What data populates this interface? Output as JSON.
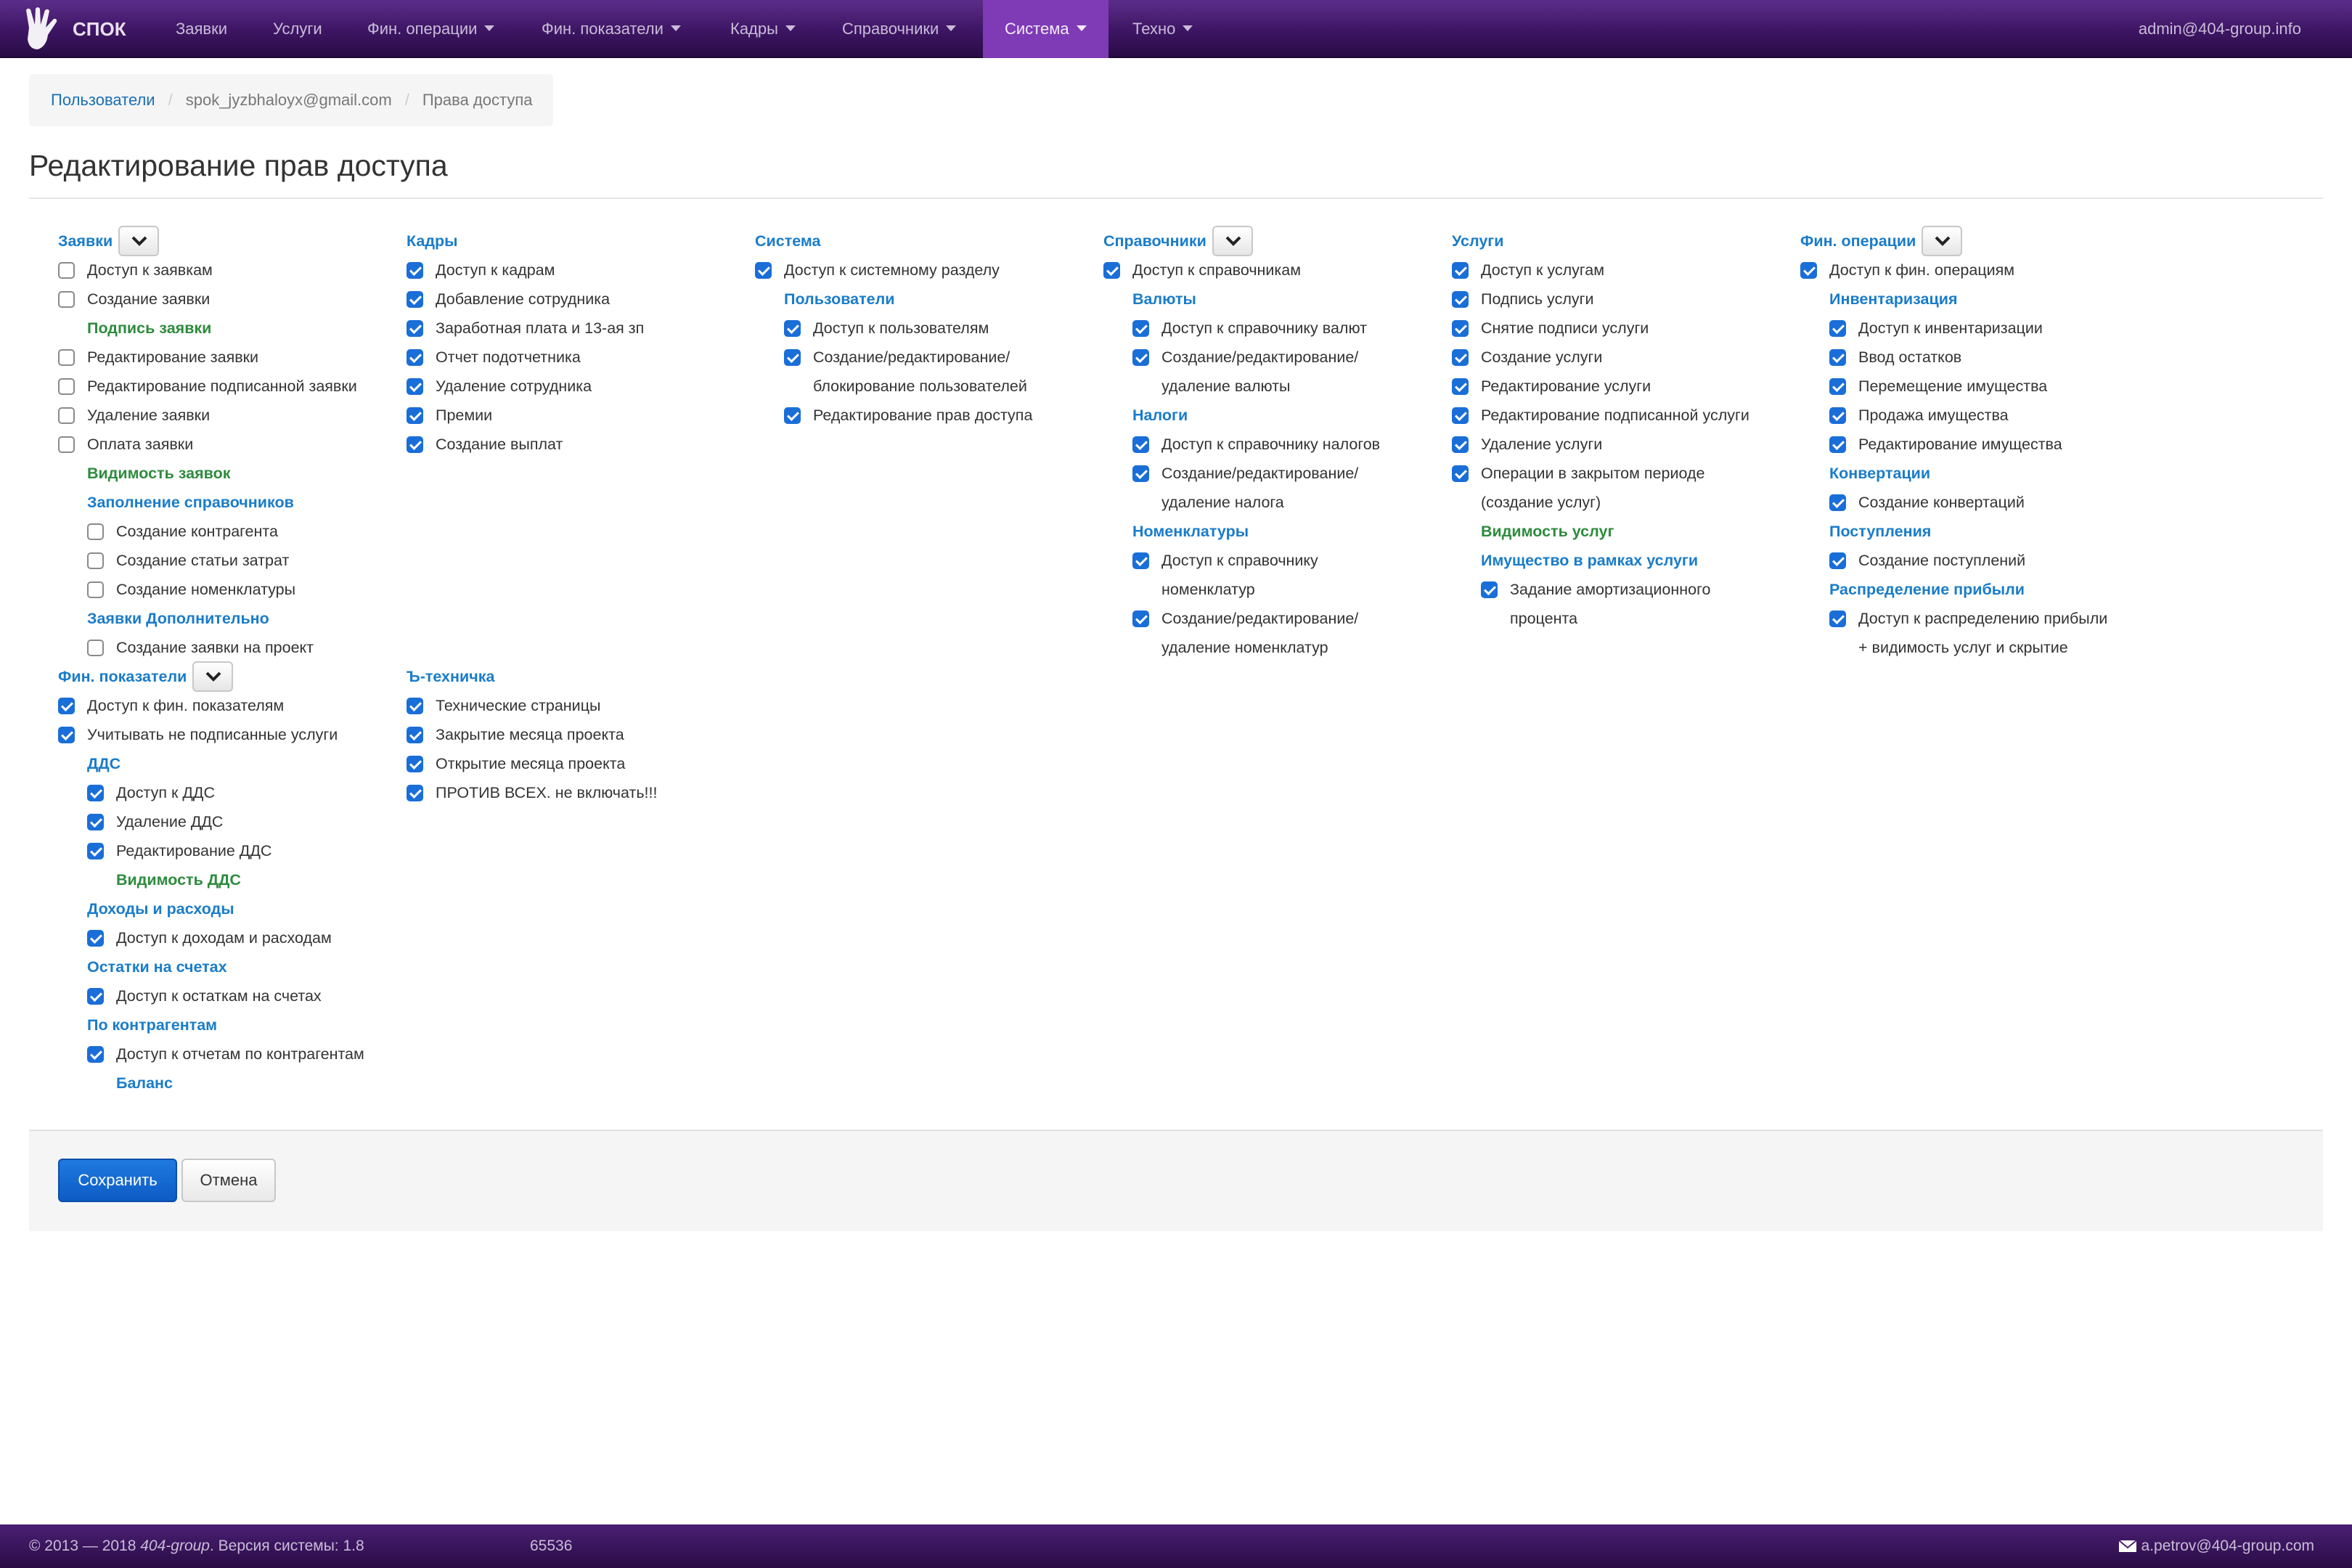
{
  "nav": {
    "brand": "СПОК",
    "items": [
      {
        "label": "Заявки",
        "dropdown": false,
        "active": false
      },
      {
        "label": "Услуги",
        "dropdown": false,
        "active": false
      },
      {
        "label": "Фин. операции",
        "dropdown": true,
        "active": false
      },
      {
        "label": "Фин. показатели",
        "dropdown": true,
        "active": false
      },
      {
        "label": "Кадры",
        "dropdown": true,
        "active": false
      },
      {
        "label": "Справочники",
        "dropdown": true,
        "active": false
      },
      {
        "label": "Система",
        "dropdown": true,
        "active": true
      },
      {
        "label": "Техно",
        "dropdown": true,
        "active": false
      }
    ],
    "user": "admin@404-group.info"
  },
  "breadcrumb": {
    "items": [
      "Пользователи",
      "spok_jyzbhaloyx@gmail.com",
      "Права доступа"
    ]
  },
  "page_title": "Редактирование прав доступа",
  "columns": [
    {
      "groups": [
        {
          "title": "Заявки",
          "toggle": true,
          "items": [
            {
              "type": "cb",
              "label": "Доступ к заявкам",
              "checked": false
            },
            {
              "type": "cb",
              "label": "Создание заявки",
              "checked": false
            },
            {
              "type": "green",
              "label": "Подпись заявки",
              "indent": 1
            },
            {
              "type": "cb",
              "label": "Редактирование заявки",
              "checked": false
            },
            {
              "type": "cb",
              "label": "Редактирование подписанной заявки",
              "checked": false
            },
            {
              "type": "cb",
              "label": "Удаление заявки",
              "checked": false
            },
            {
              "type": "cb",
              "label": "Оплата заявки",
              "checked": false
            },
            {
              "type": "green",
              "label": "Видимость заявок",
              "indent": 1
            },
            {
              "type": "head",
              "label": "Заполнение справочников",
              "indent": 1
            },
            {
              "type": "cb",
              "label": "Создание контрагента",
              "checked": false,
              "indent": 1
            },
            {
              "type": "cb",
              "label": "Создание статьи затрат",
              "checked": false,
              "indent": 1
            },
            {
              "type": "cb",
              "label": "Создание номенклатуры",
              "checked": false,
              "indent": 1
            },
            {
              "type": "head",
              "label": "Заявки Дополнительно",
              "indent": 1
            },
            {
              "type": "cb",
              "label": "Создание заявки на проект",
              "checked": false,
              "indent": 1
            }
          ]
        },
        {
          "title": "Фин. показатели",
          "toggle": true,
          "items": [
            {
              "type": "cb",
              "label": "Доступ к фин. показателям",
              "checked": true
            },
            {
              "type": "cb",
              "label": "Учитывать не подписанные услуги",
              "checked": true
            },
            {
              "type": "head",
              "label": "ДДС",
              "indent": 1
            },
            {
              "type": "cb",
              "label": "Доступ к ДДС",
              "checked": true,
              "indent": 1
            },
            {
              "type": "cb",
              "label": "Удаление ДДС",
              "checked": true,
              "indent": 1
            },
            {
              "type": "cb",
              "label": "Редактирование ДДС",
              "checked": true,
              "indent": 1
            },
            {
              "type": "green",
              "label": "Видимость ДДС",
              "indent": 2
            },
            {
              "type": "head",
              "label": "Доходы и расходы",
              "indent": 1
            },
            {
              "type": "cb",
              "label": "Доступ к доходам и расходам",
              "checked": true,
              "indent": 1
            },
            {
              "type": "head",
              "label": "Остатки на счетах",
              "indent": 1
            },
            {
              "type": "cb",
              "label": "Доступ к остаткам на счетах",
              "checked": true,
              "indent": 1
            },
            {
              "type": "head",
              "label": "По контрагентам",
              "indent": 1
            },
            {
              "type": "cb",
              "label": "Доступ к отчетам по контрагентам",
              "checked": true,
              "indent": 1
            },
            {
              "type": "head",
              "label": "Баланс",
              "indent": 2
            }
          ]
        }
      ]
    },
    {
      "groups": [
        {
          "title": "Кадры",
          "toggle": false,
          "items": [
            {
              "type": "cb",
              "label": "Доступ к кадрам",
              "checked": true
            },
            {
              "type": "cb",
              "label": "Добавление сотрудника",
              "checked": true
            },
            {
              "type": "cb",
              "label": "Заработная плата и 13-ая зп",
              "checked": true
            },
            {
              "type": "cb",
              "label": "Отчет подотчетника",
              "checked": true
            },
            {
              "type": "cb",
              "label": "Удаление сотрудника",
              "checked": true
            },
            {
              "type": "cb",
              "label": "Премии",
              "checked": true
            },
            {
              "type": "cb",
              "label": "Создание выплат",
              "checked": true
            },
            {
              "type": "spacer",
              "count": 7
            }
          ]
        },
        {
          "title": "Ъ-техничка",
          "toggle": false,
          "items": [
            {
              "type": "cb",
              "label": "Технические страницы",
              "checked": true
            },
            {
              "type": "cb",
              "label": "Закрытие месяца проекта",
              "checked": true
            },
            {
              "type": "cb",
              "label": "Открытие месяца проекта",
              "checked": true
            },
            {
              "type": "cb",
              "label": "ПРОТИВ ВСЕХ. не включать!!!",
              "checked": true
            }
          ]
        }
      ]
    },
    {
      "groups": [
        {
          "title": "Система",
          "toggle": false,
          "items": [
            {
              "type": "cb",
              "label": "Доступ к системному разделу",
              "checked": true
            },
            {
              "type": "head",
              "label": "Пользователи",
              "indent": 1
            },
            {
              "type": "cb",
              "label": "Доступ к пользователям",
              "checked": true,
              "indent": 1
            },
            {
              "type": "cb",
              "label": "Создание/редактирование/",
              "checked": true,
              "indent": 1
            },
            {
              "type": "cont",
              "label": "блокирование пользователей",
              "indent": 1
            },
            {
              "type": "cb",
              "label": "Редактирование прав доступа",
              "checked": true,
              "indent": 1
            }
          ]
        }
      ]
    },
    {
      "groups": [
        {
          "title": "Справочники",
          "toggle": true,
          "items": [
            {
              "type": "cb",
              "label": "Доступ к справочникам",
              "checked": true
            },
            {
              "type": "head",
              "label": "Валюты",
              "indent": 1
            },
            {
              "type": "cb",
              "label": "Доступ к справочнику валют",
              "checked": true,
              "indent": 1
            },
            {
              "type": "cb",
              "label": "Создание/редактирование/",
              "checked": true,
              "indent": 1
            },
            {
              "type": "cont",
              "label": "удаление валюты",
              "indent": 1
            },
            {
              "type": "head",
              "label": "Налоги",
              "indent": 1
            },
            {
              "type": "cb",
              "label": "Доступ к справочнику налогов",
              "checked": true,
              "indent": 1
            },
            {
              "type": "cb",
              "label": "Создание/редактирование/",
              "checked": true,
              "indent": 1
            },
            {
              "type": "cont",
              "label": "удаление налога",
              "indent": 1
            },
            {
              "type": "head",
              "label": "Номенклатуры",
              "indent": 1
            },
            {
              "type": "cb",
              "label": "Доступ к справочнику",
              "checked": true,
              "indent": 1
            },
            {
              "type": "cont",
              "label": "номенклатур",
              "indent": 1
            },
            {
              "type": "cb",
              "label": "Создание/редактирование/",
              "checked": true,
              "indent": 1
            },
            {
              "type": "cont",
              "label": "удаление номенклатур",
              "indent": 1
            }
          ]
        }
      ]
    },
    {
      "groups": [
        {
          "title": "Услуги",
          "toggle": false,
          "items": [
            {
              "type": "cb",
              "label": "Доступ к услугам",
              "checked": true
            },
            {
              "type": "cb",
              "label": "Подпись услуги",
              "checked": true
            },
            {
              "type": "cb",
              "label": "Снятие подписи услуги",
              "checked": true
            },
            {
              "type": "cb",
              "label": "Создание услуги",
              "checked": true
            },
            {
              "type": "cb",
              "label": "Редактирование услуги",
              "checked": true
            },
            {
              "type": "cb",
              "label": "Редактирование подписанной услуги",
              "checked": true
            },
            {
              "type": "cb",
              "label": "Удаление услуги",
              "checked": true
            },
            {
              "type": "cb",
              "label": "Операции в закрытом периоде",
              "checked": true
            },
            {
              "type": "cont",
              "label": "(создание услуг)",
              "indent": 0
            },
            {
              "type": "green",
              "label": "Видимость услуг",
              "indent": 1
            },
            {
              "type": "head",
              "label": "Имущество в рамках услуги",
              "indent": 1
            },
            {
              "type": "cb",
              "label": "Задание амортизационного",
              "checked": true,
              "indent": 1
            },
            {
              "type": "cont",
              "label": "процента",
              "indent": 1
            }
          ]
        }
      ]
    },
    {
      "groups": [
        {
          "title": "Фин. операции",
          "toggle": true,
          "items": [
            {
              "type": "cb",
              "label": "Доступ к фин. операциям",
              "checked": true
            },
            {
              "type": "head",
              "label": "Инвентаризация",
              "indent": 1
            },
            {
              "type": "cb",
              "label": "Доступ к инвентаризации",
              "checked": true,
              "indent": 1
            },
            {
              "type": "cb",
              "label": "Ввод остатков",
              "checked": true,
              "indent": 1
            },
            {
              "type": "cb",
              "label": "Перемещение имущества",
              "checked": true,
              "indent": 1
            },
            {
              "type": "cb",
              "label": "Продажа имущества",
              "checked": true,
              "indent": 1
            },
            {
              "type": "cb",
              "label": "Редактирование имущества",
              "checked": true,
              "indent": 1
            },
            {
              "type": "head",
              "label": "Конвертации",
              "indent": 1
            },
            {
              "type": "cb",
              "label": "Создание конвертаций",
              "checked": true,
              "indent": 1
            },
            {
              "type": "head",
              "label": "Поступления",
              "indent": 1
            },
            {
              "type": "cb",
              "label": "Создание поступлений",
              "checked": true,
              "indent": 1
            },
            {
              "type": "head",
              "label": "Распределение прибыли",
              "indent": 1
            },
            {
              "type": "cb",
              "label": "Доступ к распределению прибыли",
              "checked": true,
              "indent": 1
            },
            {
              "type": "cont",
              "label": "+ видимость услуг и скрытие",
              "indent": 1
            }
          ]
        }
      ]
    }
  ],
  "actions": {
    "save_label": "Сохранить",
    "cancel_label": "Отмена"
  },
  "footer": {
    "copyright_prefix": "© 2013 — 2018 ",
    "company": "404-group",
    "version_text": ". Версия системы: 1.8",
    "number": "65536",
    "email": "a.petrov@404-group.com"
  },
  "colors": {
    "accent": "#1a7cc9",
    "green": "#2e8b3d",
    "nav": "#3d1563",
    "active_nav": "#7e3bb5",
    "checkbox": "#1a6ed8"
  }
}
